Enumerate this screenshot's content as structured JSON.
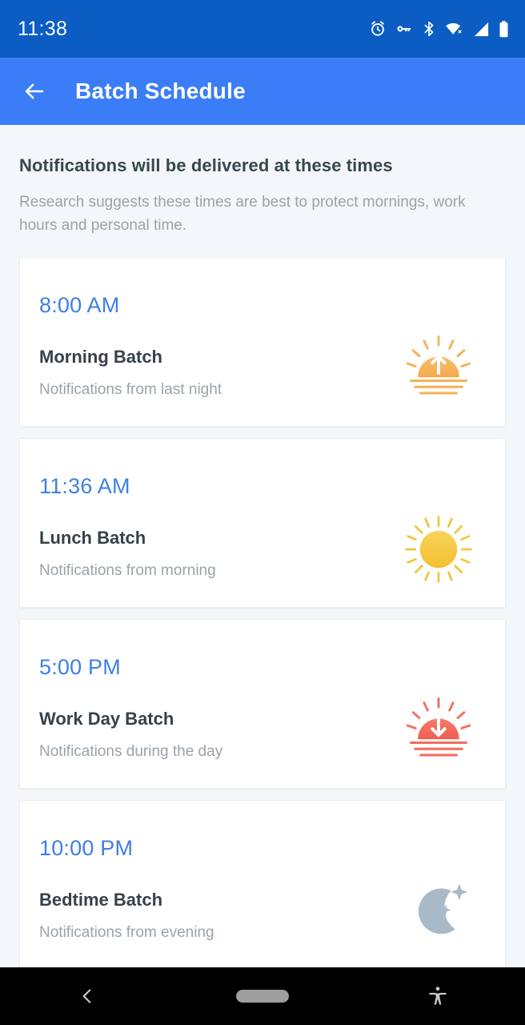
{
  "status_bar": {
    "time": "11:38",
    "icons": [
      "alarm-icon",
      "vpn-key-icon",
      "bluetooth-icon",
      "wifi-off-icon",
      "cellular-signal-icon",
      "battery-icon"
    ],
    "background_color": "#0b5dc4"
  },
  "app_bar": {
    "title": "Batch Schedule",
    "back_icon": "back-arrow-icon",
    "background_color": "#3b7df7"
  },
  "intro": {
    "title": "Notifications will be delivered at these times",
    "subtitle": "Research suggests these times are best to protect mornings, work hours and personal time."
  },
  "colors": {
    "accent_time": "#3d80e2",
    "page_background": "#f4f7f9",
    "card_background": "#ffffff",
    "title_text": "#37414a",
    "muted_text": "#9aa3ab",
    "sunrise_icon": "#f5ad54",
    "sun_icon": "#f5c93b",
    "sunset_icon": "#f26b5e",
    "moon_icon": "#a8bac8"
  },
  "cards": [
    {
      "time": "8:00 AM",
      "title": "Morning Batch",
      "subtitle": "Notifications from last night",
      "icon": "sunrise-icon"
    },
    {
      "time": "11:36 AM",
      "title": "Lunch Batch",
      "subtitle": "Notifications from morning",
      "icon": "sun-icon"
    },
    {
      "time": "5:00 PM",
      "title": "Work Day Batch",
      "subtitle": "Notifications during the day",
      "icon": "sunset-icon"
    },
    {
      "time": "10:00 PM",
      "title": "Bedtime Batch",
      "subtitle": "Notifications from evening",
      "icon": "moon-icon"
    }
  ],
  "nav_bar": {
    "items": [
      "back-nav-icon",
      "home-pill-icon",
      "accessibility-icon"
    ],
    "background_color": "#000000"
  }
}
